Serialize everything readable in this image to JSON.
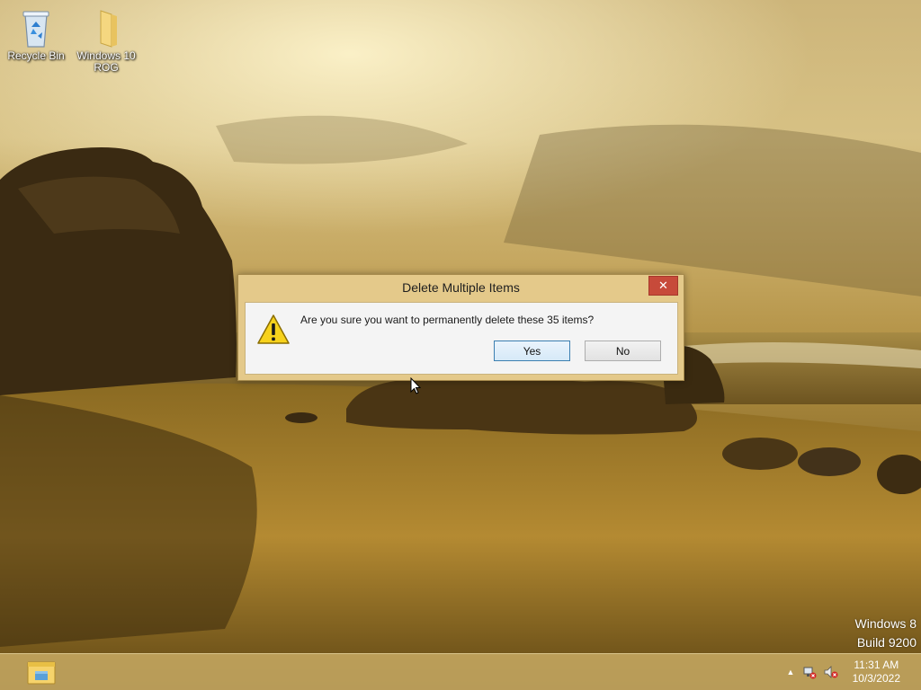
{
  "desktop": {
    "icons": [
      {
        "label": "Recycle Bin",
        "icon": "recycle-bin-icon"
      },
      {
        "label": "Windows 10 ROG",
        "icon": "folder-icon"
      }
    ],
    "watermark": {
      "line1": "Windows 8",
      "line2": "Build 9200"
    }
  },
  "dialog": {
    "title": "Delete Multiple Items",
    "message": "Are you sure you want to permanently delete these 35 items?",
    "icon": "warning-icon",
    "close_symbol": "✕",
    "yes_label": "Yes",
    "no_label": "No",
    "frame_color": "#e4c98a",
    "close_color": "#c74a3a"
  },
  "taskbar": {
    "pinned": [
      {
        "icon": "file-explorer-icon"
      }
    ],
    "tray": {
      "chevron": "▲",
      "icons": [
        "network-icon",
        "volume-muted-icon"
      ]
    },
    "clock": {
      "time": "11:31 AM",
      "date": "10/3/2022"
    }
  }
}
